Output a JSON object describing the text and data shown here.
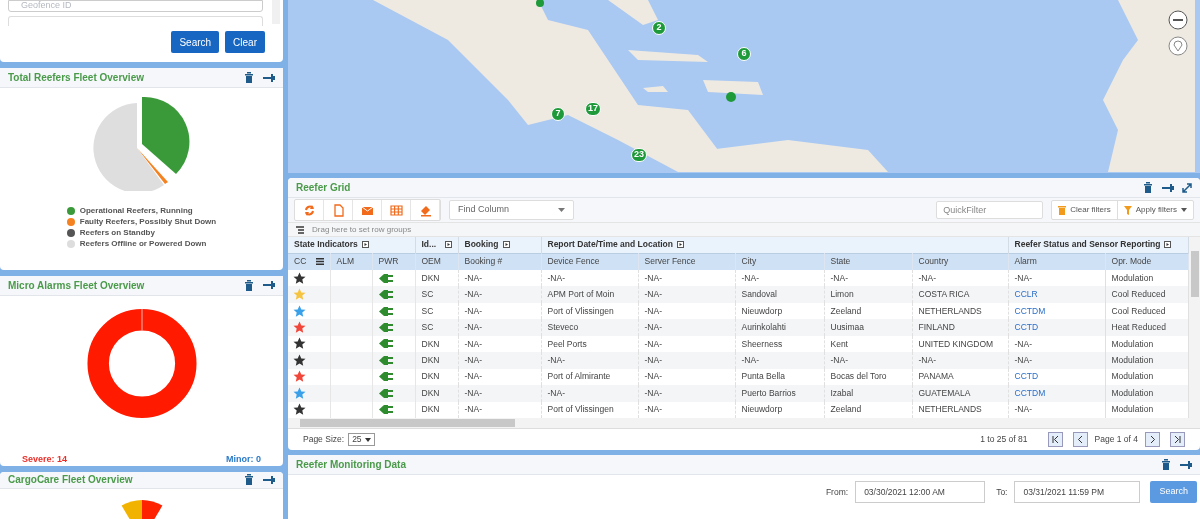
{
  "search_panel": {
    "field": {
      "placeholder": "Geofence ID"
    },
    "buttons": [
      "Search",
      "Clear"
    ]
  },
  "fleet_overview": {
    "title": "Total Reefers Fleet Overview",
    "legend": [
      {
        "label": "Operational Reefers, Running",
        "color": "#3a9a3a"
      },
      {
        "label": "Faulty Reefers, Possibly Shut Down",
        "color": "#f58220"
      },
      {
        "label": "Reefers on Standby",
        "color": "#555555"
      },
      {
        "label": "Reefers Offline or Powered Down",
        "color": "#dddddd"
      }
    ]
  },
  "micro_alarms": {
    "title": "Micro Alarms Fleet Overview",
    "severe": "Severe: 14",
    "minor": "Minor: 0"
  },
  "cargocare": {
    "title": "CargoCare Fleet Overview"
  },
  "map": {
    "clusters": [
      {
        "count": "2"
      },
      {
        "count": "6"
      },
      {
        "count": "7"
      },
      {
        "count": "17"
      },
      {
        "count": "23"
      }
    ]
  },
  "reefer_grid": {
    "title": "Reefer Grid",
    "find_column": {
      "placeholder": "Find Column"
    },
    "quick_filter": {
      "placeholder": "QuickFilter"
    },
    "clear_filters": "Clear filters",
    "apply_filters": "Apply filters",
    "group_bar": "Drag here to set row groups",
    "column_groups": [
      "State Indicators",
      "Id...",
      "Booking",
      "Report Date/Time and Location",
      "Reefer Status and Sensor Reporting"
    ],
    "columns": [
      "CC",
      "ALM",
      "PWR",
      "OEM",
      "Booking #",
      "Device Fence",
      "Server Fence",
      "City",
      "State",
      "Country",
      "Alarm",
      "Opr. Mode"
    ],
    "rows": [
      {
        "color": "#333333",
        "oem": "DKN",
        "booking": "-NA-",
        "device_fence": "-NA-",
        "server_fence": "-NA-",
        "city": "-NA-",
        "state": "-NA-",
        "country": "-NA-",
        "alarm": {
          "text": "-NA-",
          "link": false
        },
        "mode": "Modulation"
      },
      {
        "color": "#f5c542",
        "oem": "SC",
        "booking": "-NA-",
        "device_fence": "APM Port of Moin",
        "server_fence": "-NA-",
        "city": "Sandoval",
        "state": "Limon",
        "country": "COSTA RICA",
        "alarm": {
          "text": "CCLR",
          "link": true
        },
        "mode": "Cool Reduced"
      },
      {
        "color": "#3aa0e8",
        "oem": "SC",
        "booking": "-NA-",
        "device_fence": "Port of Vlissingen",
        "server_fence": "-NA-",
        "city": "Nieuwdorp",
        "state": "Zeeland",
        "country": "NETHERLANDS",
        "alarm": {
          "text": "CCTDM",
          "link": true
        },
        "mode": "Cool Reduced"
      },
      {
        "color": "#f0473a",
        "oem": "SC",
        "booking": "-NA-",
        "device_fence": "Steveco",
        "server_fence": "-NA-",
        "city": "Aurinkolahti",
        "state": "Uusimaa",
        "country": "FINLAND",
        "alarm": {
          "text": "CCTD",
          "link": true
        },
        "mode": "Heat Reduced"
      },
      {
        "color": "#333333",
        "oem": "DKN",
        "booking": "-NA-",
        "device_fence": "Peel Ports",
        "server_fence": "-NA-",
        "city": "Sheerness",
        "state": "Kent",
        "country": "UNITED KINGDOM",
        "alarm": {
          "text": "-NA-",
          "link": false
        },
        "mode": "Modulation"
      },
      {
        "color": "#333333",
        "oem": "DKN",
        "booking": "-NA-",
        "device_fence": "-NA-",
        "server_fence": "-NA-",
        "city": "-NA-",
        "state": "-NA-",
        "country": "-NA-",
        "alarm": {
          "text": "-NA-",
          "link": false
        },
        "mode": "Modulation"
      },
      {
        "color": "#f0473a",
        "oem": "DKN",
        "booking": "-NA-",
        "device_fence": "Port of Almirante",
        "server_fence": "-NA-",
        "city": "Punta Bella",
        "state": "Bocas del Toro",
        "country": "PANAMA",
        "alarm": {
          "text": "CCTD",
          "link": true
        },
        "mode": "Modulation"
      },
      {
        "color": "#3aa0e8",
        "oem": "DKN",
        "booking": "-NA-",
        "device_fence": "-NA-",
        "server_fence": "-NA-",
        "city": "Puerto Barrios",
        "state": "Izabal",
        "country": "GUATEMALA",
        "alarm": {
          "text": "CCTDM",
          "link": true
        },
        "mode": "Modulation"
      },
      {
        "color": "#333333",
        "oem": "DKN",
        "booking": "-NA-",
        "device_fence": "Port of Vlissingen",
        "server_fence": "-NA-",
        "city": "Nieuwdorp",
        "state": "Zeeland",
        "country": "NETHERLANDS",
        "alarm": {
          "text": "-NA-",
          "link": false
        },
        "mode": "Modulation"
      }
    ],
    "page_size_label": "Page Size:",
    "page_size": "25",
    "range": "1 to 25 of 81",
    "page": "Page 1 of 4"
  },
  "monitoring": {
    "title": "Reefer Monitoring Data",
    "from_label": "From:",
    "from": "03/30/2021 12:00 AM",
    "to_label": "To:",
    "to": "03/31/2021 11:59 PM",
    "button": "Search"
  }
}
